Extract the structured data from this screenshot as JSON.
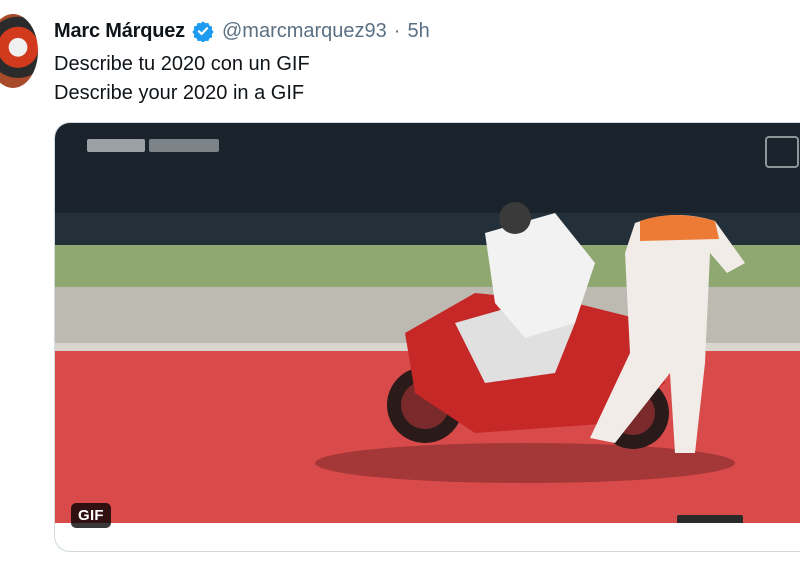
{
  "tweet": {
    "author_name": "Marc Márquez",
    "handle": "@marcmarquez93",
    "separator": "·",
    "time": "5h",
    "text_lines": [
      "Describe tu 2020 con un GIF",
      "Describe your 2020 in a GIF"
    ]
  },
  "media": {
    "badge": "GIF"
  },
  "icons": {
    "verified": "verified-badge-icon",
    "avatar": "avatar"
  },
  "colors": {
    "verified": "#1d9bf0",
    "muted_text": "#5b7083",
    "primary_text": "#0f1419",
    "track_red": "#d94a4a"
  }
}
